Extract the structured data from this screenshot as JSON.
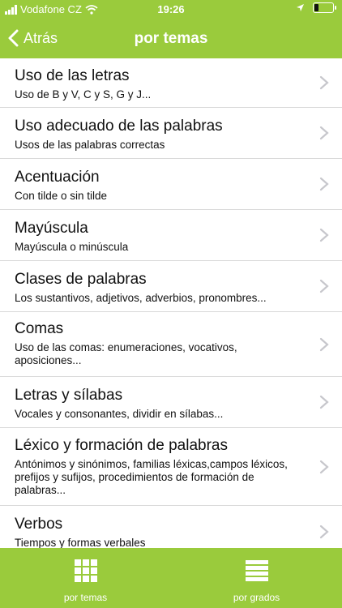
{
  "status_bar": {
    "carrier": "Vodafone CZ",
    "time": "19:26"
  },
  "nav": {
    "back_label": "Atrás",
    "title": "por temas"
  },
  "list": [
    {
      "title": "Uso de las letras",
      "subtitle": "Uso de B y V, C y S, G y J..."
    },
    {
      "title": "Uso adecuado de las palabras",
      "subtitle": "Usos de las palabras correctas"
    },
    {
      "title": "Acentuación",
      "subtitle": "Con tilde o sin tilde"
    },
    {
      "title": "Mayúscula",
      "subtitle": "Mayúscula o minúscula"
    },
    {
      "title": "Clases de palabras",
      "subtitle": "Los sustantivos, adjetivos, adverbios, pronombres..."
    },
    {
      "title": "Comas",
      "subtitle": "Uso de las comas: enumeraciones, vocativos, aposiciones..."
    },
    {
      "title": "Letras y sílabas",
      "subtitle": "Vocales y consonantes, dividir en sílabas..."
    },
    {
      "title": "Léxico y formación de palabras",
      "subtitle": "Antónimos y sinónimos, familias léxicas,campos léxicos, prefijos y sufijos, procedimientos de formación de palabras..."
    },
    {
      "title": "Verbos",
      "subtitle": "Tiempos y formas verbales"
    }
  ],
  "tabbar": {
    "tab_temas": "por temas",
    "tab_grados": "por grados"
  },
  "colors": {
    "accent": "#9acb3c",
    "chevron": "#c7c7cc",
    "divider": "#d9d9d9"
  }
}
